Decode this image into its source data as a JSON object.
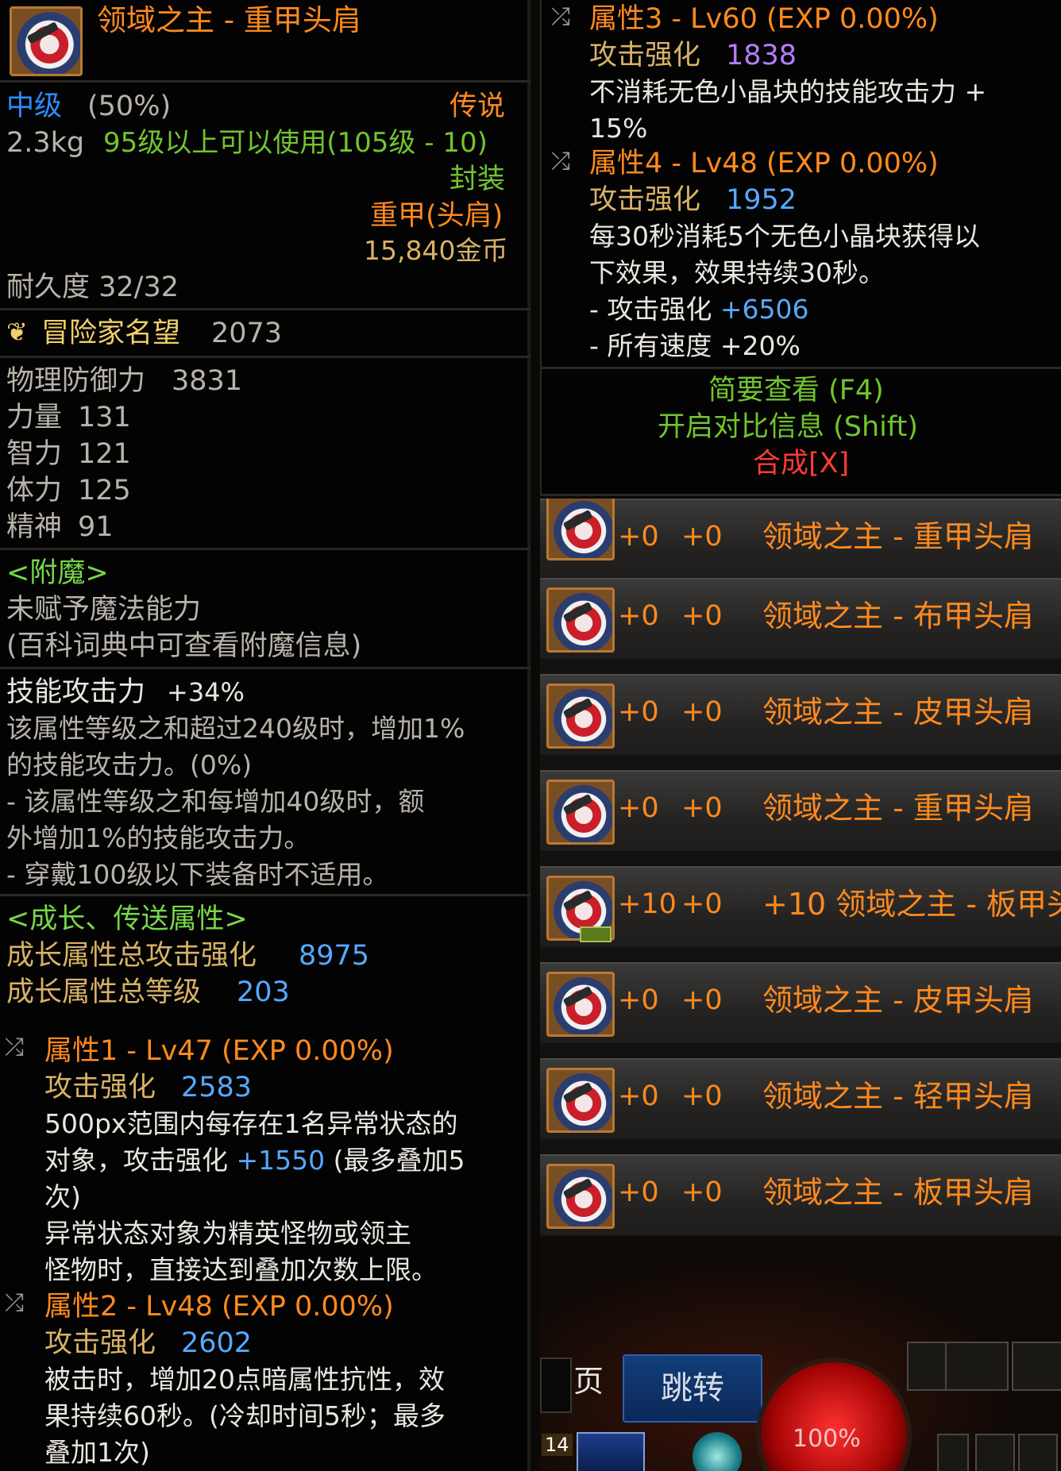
{
  "left": {
    "title": "领域之主 - 重甲头肩",
    "grade": "中级",
    "grade_pct": "(50%)",
    "rarity": "传说",
    "weight": "2.3kg",
    "level_req": "95级以上可以使用(105级 - 10)",
    "seal": "封装",
    "type": "重甲(头肩)",
    "price": "15,840金币",
    "durability": "耐久度 32/32",
    "fame_label": "冒险家名望",
    "fame_value": "2073",
    "stats": [
      {
        "label": "物理防御力",
        "value": "3831"
      },
      {
        "label": "力量",
        "value": "131"
      },
      {
        "label": "智力",
        "value": "121"
      },
      {
        "label": "体力",
        "value": "125"
      },
      {
        "label": "精神",
        "value": "91"
      }
    ],
    "enchant_header": "<附魔>",
    "enchant_none": "未赋予魔法能力",
    "enchant_hint": "(百科词典中可查看附魔信息)",
    "skill_label": "技能攻击力",
    "skill_value": "+34%",
    "skill_desc": [
      "该属性等级之和超过240级时，增加1%",
      "的技能攻击力。(0%)",
      "- 该属性等级之和每增加40级时，额",
      "外增加1%的技能攻击力。",
      "- 穿戴100级以下装备时不适用。"
    ],
    "growth_header": "<成长、传送属性>",
    "growth_atk_label": "成长属性总攻击强化",
    "growth_atk_value": "8975",
    "growth_lv_label": "成长属性总等级",
    "growth_lv_value": "203",
    "attr1": {
      "title": "属性1 - Lv47 (EXP 0.00%)",
      "atk_label": "攻击强化",
      "atk_value": "2583",
      "desc1": "500px范围内每存在1名异常状态的",
      "desc2a": "对象，攻击强化 ",
      "desc2b": "+1550",
      "desc2c": " (最多叠加5",
      "desc3": "次)",
      "desc4": "异常状态对象为精英怪物或领主",
      "desc5": "怪物时，直接达到叠加次数上限。"
    },
    "attr2": {
      "title": "属性2 - Lv48 (EXP 0.00%)",
      "atk_label": "攻击强化",
      "atk_value": "2602",
      "desc1": "被击时，增加20点暗属性抗性，效",
      "desc2": "果持续60秒。(冷却时间5秒；最多",
      "desc3": "叠加1次)"
    }
  },
  "right": {
    "attr3": {
      "title": "属性3 - Lv60 (EXP 0.00%)",
      "atk_label": "攻击强化",
      "atk_value": "1838",
      "desc1": "不消耗无色小晶块的技能攻击力 +",
      "desc2": "15%"
    },
    "attr4": {
      "title": "属性4 - Lv48 (EXP 0.00%)",
      "atk_label": "攻击强化",
      "atk_value": "1952",
      "desc1": "每30秒消耗5个无色小晶块获得以",
      "desc2": "下效果，效果持续30秒。",
      "eff1_label": "- 攻击强化 ",
      "eff1_value": "+6506",
      "eff2_label": "- 所有速度 ",
      "eff2_value": "+20%"
    },
    "brief_view": "简要查看 (F4)",
    "compare": "开启对比信息 (Shift)",
    "synth": "合成[X]"
  },
  "list": [
    {
      "p1": "+0",
      "p2": "+0",
      "name": "领域之主 - 重甲头肩"
    },
    {
      "p1": "+0",
      "p2": "+0",
      "name": "领域之主 - 布甲头肩"
    },
    {
      "p1": "+0",
      "p2": "+0",
      "name": "领域之主 - 皮甲头肩"
    },
    {
      "p1": "+0",
      "p2": "+0",
      "name": "领域之主 - 重甲头肩"
    },
    {
      "p1": "+10",
      "p2": "+0",
      "name": "+10 领域之主 - 板甲头"
    },
    {
      "p1": "+0",
      "p2": "+0",
      "name": "领域之主 - 皮甲头肩"
    },
    {
      "p1": "+0",
      "p2": "+0",
      "name": "领域之主 - 轻甲头肩"
    },
    {
      "p1": "+0",
      "p2": "+0",
      "name": "领域之主 - 板甲头肩"
    }
  ],
  "bottom": {
    "page_label": "页",
    "jump_label": "跳转",
    "hp_pct": "100%",
    "slot_num": "14"
  }
}
